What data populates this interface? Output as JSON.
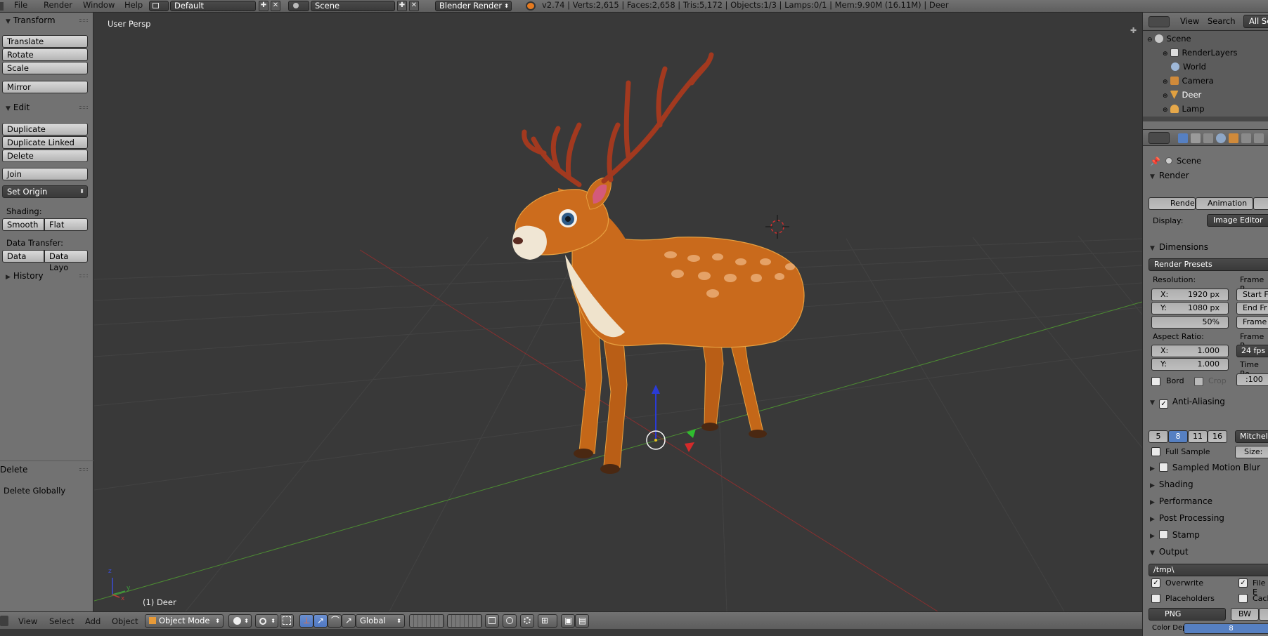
{
  "topbar": {
    "menus": [
      "File",
      "Render",
      "Window",
      "Help"
    ],
    "screen_layout": "Default",
    "scene": "Scene",
    "engine": "Blender Render",
    "status": "v2.74 | Verts:2,615 | Faces:2,658 | Tris:5,172 | Objects:1/3 | Lamps:0/1 | Mem:9.90M (16.11M) | Deer"
  },
  "toolshelf": {
    "transform": {
      "title": "Transform",
      "buttons": [
        "Translate",
        "Rotate",
        "Scale",
        "Mirror"
      ]
    },
    "edit": {
      "title": "Edit",
      "buttons": [
        "Duplicate",
        "Duplicate Linked",
        "Delete",
        "Join"
      ],
      "set_origin": "Set Origin",
      "shading_label": "Shading:",
      "smooth": "Smooth",
      "flat": "Flat",
      "data_transfer_label": "Data Transfer:",
      "data": "Data",
      "data_layout": "Data Layo"
    },
    "history": "History",
    "operator": {
      "title": "Delete",
      "option": "Delete Globally"
    }
  },
  "viewport": {
    "view_label": "User Persp",
    "object_label": "(1) Deer",
    "axis_x": "x",
    "axis_y": "y",
    "axis_z": "z"
  },
  "viewport_header": {
    "menus": [
      "View",
      "Select",
      "Add",
      "Object"
    ],
    "mode": "Object Mode",
    "orientation": "Global"
  },
  "outliner": {
    "header": {
      "view": "View",
      "search": "Search",
      "filter": "All Sc"
    },
    "items": [
      {
        "label": "Scene",
        "icon": "scene-icon"
      },
      {
        "label": "RenderLayers",
        "icon": "render-layers-icon"
      },
      {
        "label": "World",
        "icon": "world-icon"
      },
      {
        "label": "Camera",
        "icon": "camera-icon"
      },
      {
        "label": "Deer",
        "icon": "mesh-icon"
      },
      {
        "label": "Lamp",
        "icon": "lamp-icon"
      }
    ]
  },
  "properties": {
    "context": "Scene",
    "render": {
      "title": "Render",
      "render_btn": "Render",
      "animation_btn": "Animation",
      "display_label": "Display:",
      "display_value": "Image Editor"
    },
    "dimensions": {
      "title": "Dimensions",
      "presets": "Render Presets",
      "resolution_label": "Resolution:",
      "res_x": "1920 px",
      "res_y": "1080 px",
      "res_pct": "50%",
      "x_label": "X:",
      "y_label": "Y:",
      "aspect_label": "Aspect Ratio:",
      "aspect_x": "1.000",
      "aspect_y": "1.000",
      "border": "Bord",
      "crop": "Crop",
      "frame_range_label": "Frame R",
      "start": "Start F",
      "end": "End Fr",
      "frame": "Frame",
      "frame_rate_label": "Frame R",
      "fps": "24 fps",
      "time_remap_label": "Time Re",
      "time_remap": ":100"
    },
    "anti_aliasing": {
      "title": "Anti-Aliasing",
      "samples": [
        "5",
        "8",
        "11",
        "16"
      ],
      "selected": "8",
      "filter": "Mitchell",
      "full_sample": "Full Sample",
      "size": "Size:"
    },
    "collapsed": [
      "Sampled Motion Blur",
      "Shading",
      "Performance",
      "Post Processing",
      "Stamp"
    ],
    "output": {
      "title": "Output",
      "path": "/tmp\\",
      "overwrite": "Overwrite",
      "file_ext": "File E",
      "placeholders": "Placeholders",
      "cache": "Cach",
      "format": "PNG",
      "bw": "BW",
      "color_depth_label": "Color Depth:",
      "color_depth": "8"
    }
  },
  "colors": {
    "selection_blue": "#5680c2",
    "deer_body": "#c8661a",
    "antler": "#a2391f"
  }
}
